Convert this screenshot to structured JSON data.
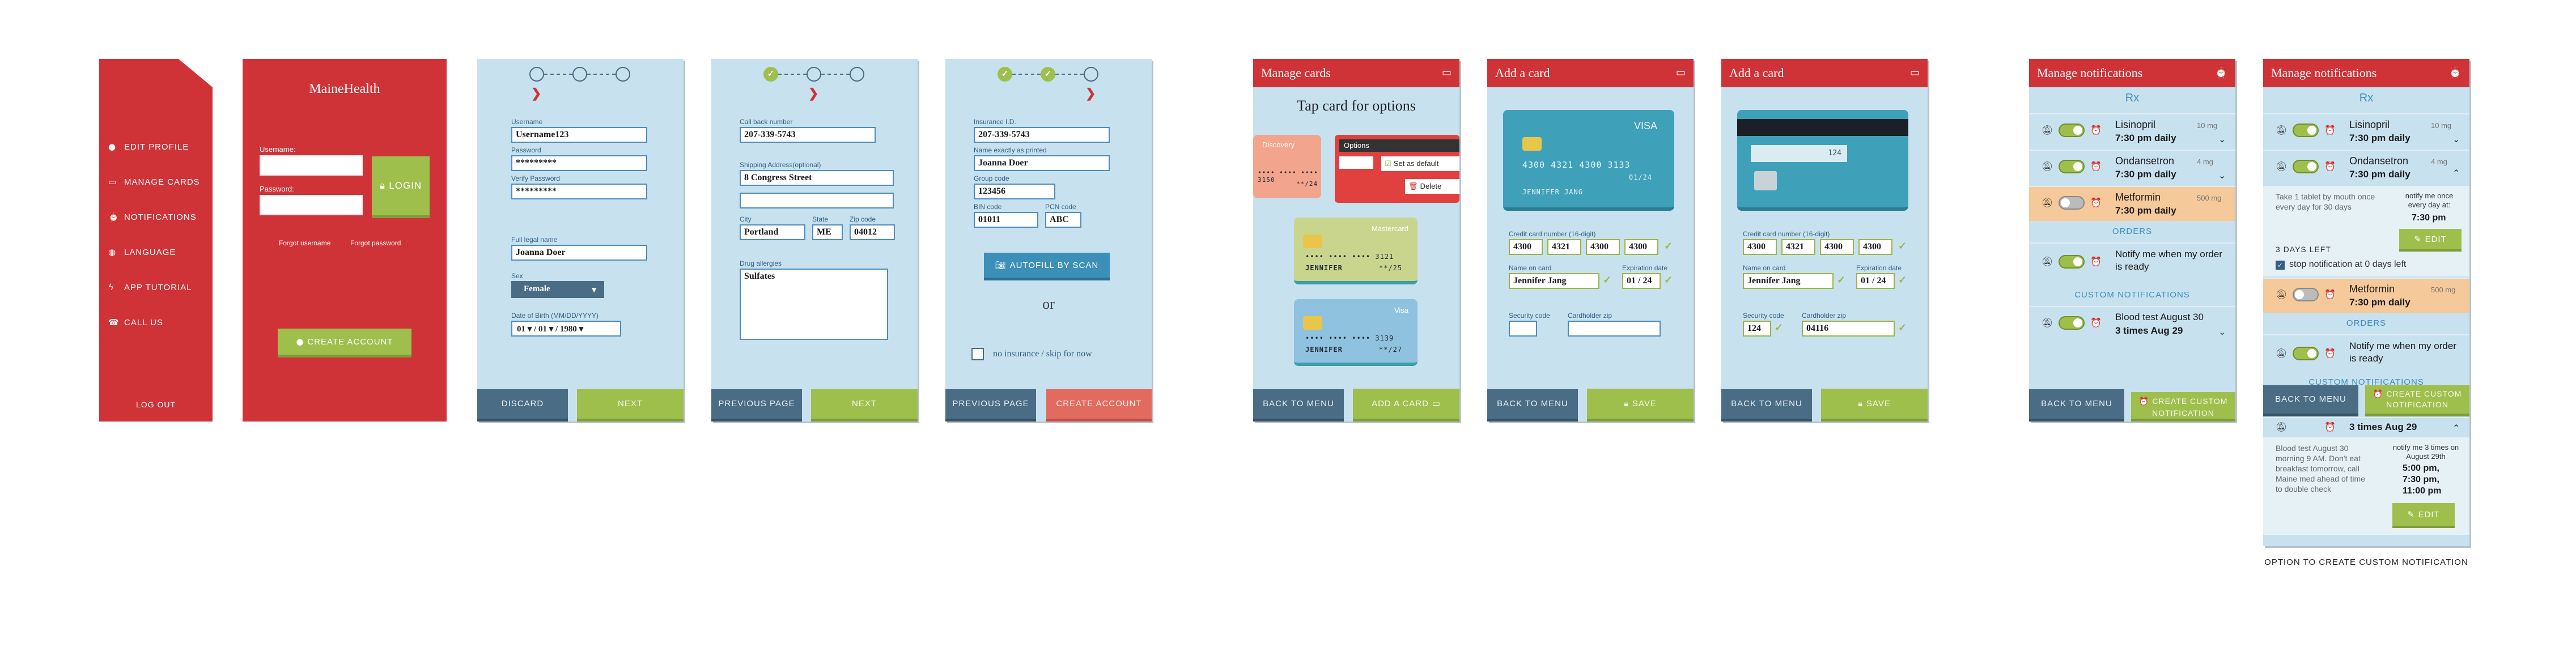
{
  "menu_screen": {
    "items": [
      {
        "icon": "user-icon",
        "label": "EDIT PROFILE"
      },
      {
        "icon": "card-icon",
        "label": "MANAGE CARDS"
      },
      {
        "icon": "alarm-icon",
        "label": "NOTIFICATIONS"
      },
      {
        "icon": "globe-icon",
        "label": "LANGUAGE"
      },
      {
        "icon": "bolt-icon",
        "label": "APP TUTORIAL"
      },
      {
        "icon": "phone-icon",
        "label": "CALL US"
      }
    ],
    "logout": "LOG OUT"
  },
  "login_screen": {
    "brand": "MaineHealth",
    "username_label": "Username:",
    "password_label": "Password:",
    "login_button": "LOGIN",
    "forgot_username": "Forgot username",
    "forgot_password": "Forgot password",
    "create_account": "CREATE ACCOUNT"
  },
  "signup_step1": {
    "username_label": "Username",
    "username_value": "Username123",
    "password_label": "Password",
    "password_value": "*********",
    "verify_label": "Verify Password",
    "verify_value": "*********",
    "fullname_label": "Full legal name",
    "fullname_value": "Joanna Doer",
    "sex_label": "Sex",
    "sex_value": "Female",
    "dob_label": "Date of Birth (MM/DD/YYYY)",
    "dob_month": "01",
    "dob_day": "01",
    "dob_year": "1980",
    "discard": "DISCARD",
    "next": "NEXT"
  },
  "signup_step2": {
    "callback_label": "Call back number",
    "callback_value": "207-339-5743",
    "address_label": "Shipping Address(optional)",
    "address_value": "8 Congress Street",
    "city_label": "City",
    "city_value": "Portland",
    "state_label": "State",
    "state_value": "ME",
    "zip_label": "Zip code",
    "zip_value": "04012",
    "allergies_label": "Drug allergies",
    "allergies_value": "Sulfates",
    "previous": "PREVIOUS PAGE",
    "next": "NEXT"
  },
  "signup_step3": {
    "insurance_label": "Insurance I.D.",
    "insurance_value": "207-339-5743",
    "name_label": "Name exactly as printed",
    "name_value": "Joanna Doer",
    "group_label": "Group code",
    "group_value": "123456",
    "bin_label": "BIN code",
    "bin_value": "01011",
    "pcn_label": "PCN code",
    "pcn_value": "ABC",
    "autofill": "AUTOFILL BY SCAN",
    "or": "or",
    "no_insurance": "no insurance / skip for now",
    "previous": "PREVIOUS PAGE",
    "create": "CREATE ACCOUNT"
  },
  "manage_cards": {
    "title": "Manage cards",
    "heading": "Tap card for options",
    "card1_brand": "Discovery",
    "card1_number": "•••• •••• •••• 3150",
    "card1_exp": "**/24",
    "options_title": "Options",
    "set_default": "Set as default",
    "delete": "Delete",
    "card2_brand": "Mastercard",
    "card2_number": "•••• •••• •••• 3121",
    "card2_name": "JENNIFER",
    "card2_exp": "**/25",
    "card3_brand": "Visa",
    "card3_number": "•••• •••• •••• 3139",
    "card3_name": "JENNIFER",
    "card3_exp": "**/27",
    "back": "BACK TO MENU",
    "add": "ADD A CARD"
  },
  "add_card_front": {
    "title": "Add a card",
    "brand": "VISA",
    "card_number": "4300 4321 4300 3133",
    "card_exp": "01/24",
    "card_name": "JENNIFER JANG",
    "number_label": "Credit card number (16-digit)",
    "n1": "4300",
    "n2": "4321",
    "n3": "4300",
    "n4": "4300",
    "name_label": "Name on card",
    "name_value": "Jennifer Jang",
    "exp_label": "Expiration date",
    "exp_month": "01",
    "exp_year": "24",
    "sec_label": "Security code",
    "sec_value": "",
    "zip_label": "Cardholder zip",
    "zip_value": "",
    "back": "BACK TO MENU",
    "save": "SAVE"
  },
  "add_card_back": {
    "title": "Add a card",
    "cvv": "124",
    "number_label": "Credit card number (16-digit)",
    "n1": "4300",
    "n2": "4321",
    "n3": "4300",
    "n4": "4300",
    "name_label": "Name on card",
    "name_value": "Jennifer Jang",
    "exp_label": "Expiration date",
    "exp_month": "01",
    "exp_year": "24",
    "sec_label": "Security code",
    "sec_value": "124",
    "zip_label": "Cardholder zip",
    "zip_value": "04116",
    "back": "BACK TO MENU",
    "save": "SAVE"
  },
  "notifications1": {
    "title": "Manage notifications",
    "rx": "Rx",
    "meds": [
      {
        "name": "Lisinopril",
        "dose": "10 mg",
        "time": "7:30 pm daily"
      },
      {
        "name": "Ondansetron",
        "dose": "4 mg",
        "time": "7:30 pm daily"
      },
      {
        "name": "Metformin",
        "dose": "500 mg",
        "time": "7:30 pm daily"
      }
    ],
    "orders": "ORDERS",
    "order_text": "Notify me when my order is ready",
    "custom": "CUSTOM NOTIFICATIONS",
    "custom_title": "Blood test August 30",
    "custom_time": "3 times Aug 29",
    "back": "BACK TO MENU",
    "create": "CREATE CUSTOM NOTIFICATION"
  },
  "notifications2": {
    "title": "Manage notifications",
    "rx": "Rx",
    "med1_name": "Lisinopril",
    "med1_dose": "10 mg",
    "med1_time": "7:30 pm daily",
    "med2_name": "Ondansetron",
    "med2_dose": "4 mg",
    "med2_time": "7:30 pm daily",
    "instructions": "Take 1 tablet by mouth once every day for 30 days",
    "notify_text": "notify me once every day at:",
    "notify_time": "7:30 pm",
    "edit": "EDIT",
    "days_left": "3 DAYS LEFT",
    "stop_text": "stop notification at 0 days left",
    "med3_name": "Metformin",
    "med3_dose": "500 mg",
    "med3_time": "7:30 pm daily",
    "orders": "ORDERS",
    "order_text": "Notify me when my order is ready",
    "custom": "CUSTOM NOTIFICATIONS",
    "custom_time": "3 times Aug 29",
    "custom_note": "Blood test August 30 morning 9 AM. Don't eat breakfast tomorrow, call Maine med ahead of time to double check",
    "custom_notify": "notify me 3 times on August 29th",
    "times": [
      "5:00 pm,",
      "7:30 pm,",
      "11:00 pm"
    ],
    "edit2": "EDIT",
    "back": "BACK TO MENU",
    "create": "CREATE CUSTOM NOTIFICATION",
    "caption": "OPTION TO CREATE CUSTOM NOTIFICATION"
  },
  "colors": {
    "brand_red": "#cf3337",
    "panel_blue": "#c8e1ee",
    "accent_green": "#9fbf4d",
    "dark_button": "#4a6c84",
    "highlight_orange": "#f5c99a"
  }
}
